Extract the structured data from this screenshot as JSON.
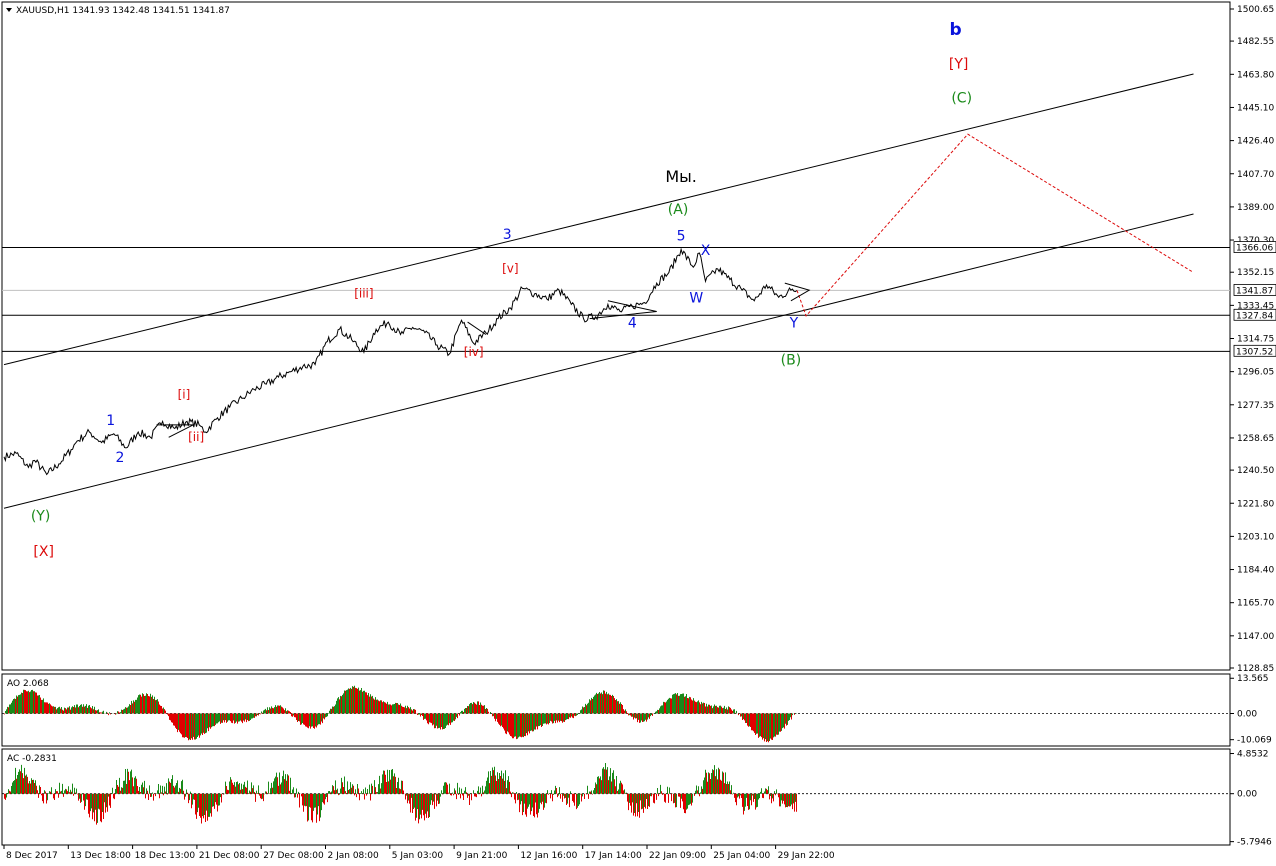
{
  "header": {
    "symbol_line": "XAUUSD,H1  1341.93 1342.48 1341.51 1341.87"
  },
  "colors": {
    "blue": "#0a14dc",
    "red": "#dc0a0a",
    "green": "#1a8a1a",
    "black": "#000000",
    "bull": "#1a8a1a",
    "bear": "#e00000"
  },
  "chart_data": [
    {
      "type": "line",
      "title": "XAUUSD,H1",
      "ylim": [
        1128.85,
        1500.65
      ],
      "y_ticks": [
        "1500.65",
        "1482.55",
        "1463.80",
        "1445.10",
        "1426.40",
        "1407.70",
        "1389.00",
        "1370.30",
        "1352.15",
        "1333.45",
        "1314.75",
        "1296.05",
        "1277.35",
        "1258.65",
        "1240.50",
        "1221.80",
        "1203.10",
        "1184.40",
        "1165.70",
        "1147.00",
        "1128.85"
      ],
      "price_labels": [
        "1366.06",
        "1341.87",
        "1327.84",
        "1307.52"
      ],
      "horizontal_lines": [
        1366.06,
        1327.84,
        1307.52
      ],
      "current_price": 1341.87,
      "x_ticks": [
        "8 Dec 2017",
        "13 Dec 18:00",
        "18 Dec 13:00",
        "21 Dec 08:00",
        "27 Dec 08:00",
        "2 Jan 08:00",
        "5 Jan 03:00",
        "9 Jan 21:00",
        "12 Jan 16:00",
        "17 Jan 14:00",
        "22 Jan 09:00",
        "25 Jan 04:00",
        "29 Jan 22:00"
      ],
      "price_path": [
        {
          "t": 0,
          "p": 1248
        },
        {
          "t": 2,
          "p": 1250
        },
        {
          "t": 4,
          "p": 1242
        },
        {
          "t": 5,
          "p": 1246
        },
        {
          "t": 7,
          "p": 1238
        },
        {
          "t": 9,
          "p": 1244
        },
        {
          "t": 11,
          "p": 1252
        },
        {
          "t": 12,
          "p": 1257
        },
        {
          "t": 14,
          "p": 1262
        },
        {
          "t": 16,
          "p": 1256
        },
        {
          "t": 18,
          "p": 1261
        },
        {
          "t": 20,
          "p": 1253
        },
        {
          "t": 22,
          "p": 1262
        },
        {
          "t": 24,
          "p": 1259
        },
        {
          "t": 26,
          "p": 1268
        },
        {
          "t": 28,
          "p": 1264
        },
        {
          "t": 30,
          "p": 1268
        },
        {
          "t": 32,
          "p": 1266
        },
        {
          "t": 33,
          "p": 1262
        },
        {
          "t": 35,
          "p": 1270
        },
        {
          "t": 37,
          "p": 1276
        },
        {
          "t": 39,
          "p": 1281
        },
        {
          "t": 41,
          "p": 1286
        },
        {
          "t": 43,
          "p": 1289
        },
        {
          "t": 45,
          "p": 1293
        },
        {
          "t": 47,
          "p": 1296
        },
        {
          "t": 49,
          "p": 1299
        },
        {
          "t": 51,
          "p": 1300
        },
        {
          "t": 53,
          "p": 1313
        },
        {
          "t": 55,
          "p": 1320
        },
        {
          "t": 57,
          "p": 1314
        },
        {
          "t": 59,
          "p": 1307
        },
        {
          "t": 61,
          "p": 1320
        },
        {
          "t": 63,
          "p": 1324
        },
        {
          "t": 65,
          "p": 1317
        },
        {
          "t": 67,
          "p": 1321
        },
        {
          "t": 69,
          "p": 1318
        },
        {
          "t": 71,
          "p": 1311
        },
        {
          "t": 73,
          "p": 1306
        },
        {
          "t": 75,
          "p": 1325
        },
        {
          "t": 77,
          "p": 1312
        },
        {
          "t": 79,
          "p": 1318
        },
        {
          "t": 81,
          "p": 1326
        },
        {
          "t": 83,
          "p": 1332
        },
        {
          "t": 85,
          "p": 1343
        },
        {
          "t": 87,
          "p": 1340
        },
        {
          "t": 89,
          "p": 1337
        },
        {
          "t": 91,
          "p": 1342
        },
        {
          "t": 93,
          "p": 1334
        },
        {
          "t": 95,
          "p": 1326
        },
        {
          "t": 97,
          "p": 1327
        },
        {
          "t": 99,
          "p": 1334
        },
        {
          "t": 101,
          "p": 1330
        },
        {
          "t": 103,
          "p": 1333
        },
        {
          "t": 105,
          "p": 1335
        },
        {
          "t": 107,
          "p": 1346
        },
        {
          "t": 109,
          "p": 1352
        },
        {
          "t": 111,
          "p": 1365
        },
        {
          "t": 113,
          "p": 1355
        },
        {
          "t": 114,
          "p": 1363
        },
        {
          "t": 115,
          "p": 1347
        },
        {
          "t": 117,
          "p": 1354
        },
        {
          "t": 119,
          "p": 1348
        },
        {
          "t": 121,
          "p": 1342
        },
        {
          "t": 123,
          "p": 1336
        },
        {
          "t": 125,
          "p": 1345
        },
        {
          "t": 127,
          "p": 1338
        },
        {
          "t": 129,
          "p": 1342
        },
        {
          "t": 130,
          "p": 1341.87
        }
      ],
      "forecast_path": [
        {
          "t": 130,
          "p": 1341.87
        },
        {
          "t": 131.5,
          "p": 1327.5
        },
        {
          "t": 158,
          "p": 1430
        },
        {
          "t": 195,
          "p": 1352
        }
      ],
      "trend_lines": [
        {
          "t1": 0,
          "p1": 1300,
          "t2": 195,
          "p2": 1464
        },
        {
          "t1": 0,
          "p1": 1219,
          "t2": 195,
          "p2": 1385
        }
      ],
      "wave_labels": [
        {
          "text": "b",
          "t": 156,
          "p": 1486,
          "color": "blue",
          "size": 17,
          "bold": true
        },
        {
          "text": "[Y]",
          "t": 156.5,
          "p": 1467,
          "color": "red",
          "size": 14
        },
        {
          "text": "(C)",
          "t": 157,
          "p": 1448,
          "color": "green",
          "size": 14
        },
        {
          "text": "Мы.",
          "t": 111,
          "p": 1403,
          "color": "black",
          "size": 16
        },
        {
          "text": "(A)",
          "t": 110.5,
          "p": 1385,
          "color": "green",
          "size": 14
        },
        {
          "text": "5",
          "t": 111,
          "p": 1370,
          "color": "blue",
          "size": 14
        },
        {
          "text": "X",
          "t": 115,
          "p": 1362,
          "color": "blue",
          "size": 14
        },
        {
          "text": "W",
          "t": 113.5,
          "p": 1335,
          "color": "blue",
          "size": 14
        },
        {
          "text": "3",
          "t": 82.5,
          "p": 1371,
          "color": "blue",
          "size": 14
        },
        {
          "text": "[v]",
          "t": 83,
          "p": 1352,
          "color": "red",
          "size": 12
        },
        {
          "text": "[iii]",
          "t": 59,
          "p": 1338,
          "color": "red",
          "size": 12
        },
        {
          "text": "[iv]",
          "t": 77,
          "p": 1305,
          "color": "red",
          "size": 12
        },
        {
          "text": "4",
          "t": 103,
          "p": 1321,
          "color": "blue",
          "size": 14
        },
        {
          "text": "Y",
          "t": 129.5,
          "p": 1321,
          "color": "blue",
          "size": 14
        },
        {
          "text": "(B)",
          "t": 129,
          "p": 1300,
          "color": "green",
          "size": 14
        },
        {
          "text": "1",
          "t": 17.5,
          "p": 1266,
          "color": "blue",
          "size": 14
        },
        {
          "text": "2",
          "t": 19,
          "p": 1245,
          "color": "blue",
          "size": 14
        },
        {
          "text": "[i]",
          "t": 29.5,
          "p": 1281,
          "color": "red",
          "size": 12
        },
        {
          "text": "[ii]",
          "t": 31.5,
          "p": 1257,
          "color": "red",
          "size": 12
        },
        {
          "text": "(Y)",
          "t": 6,
          "p": 1212,
          "color": "green",
          "size": 14
        },
        {
          "text": "[X]",
          "t": 6.5,
          "p": 1192,
          "color": "red",
          "size": 14
        }
      ]
    },
    {
      "type": "bar",
      "title": "AO 2.068",
      "ylim": [
        -12.5,
        15.2
      ],
      "y_ticks": [
        "13.565",
        "0.00",
        "-10.069"
      ],
      "zero_line": 0
    },
    {
      "type": "bar",
      "title": "AC -0.2831",
      "ylim": [
        -6.2,
        5.4
      ],
      "y_ticks": [
        "4.8532",
        "0.00",
        "-5.7946"
      ],
      "zero_line": 0
    }
  ]
}
